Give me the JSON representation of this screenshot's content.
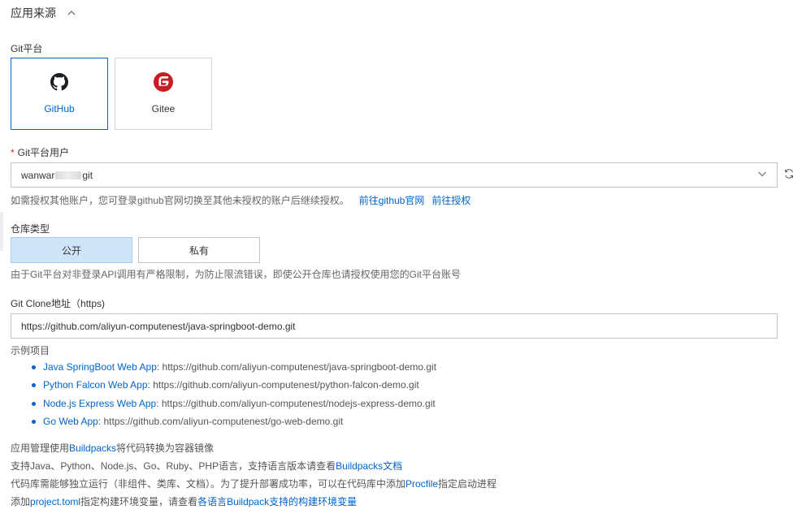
{
  "section": {
    "title": "应用来源"
  },
  "git_platform": {
    "label": "Git平台",
    "options": [
      {
        "name": "GitHub",
        "selected": true
      },
      {
        "name": "Gitee",
        "selected": false
      }
    ]
  },
  "git_user": {
    "required_mark": "*",
    "label": "Git平台用户",
    "value_prefix": "wanwar",
    "value_suffix": "git",
    "help_text": "如需授权其他账户，您可登录github官网切换至其他未授权的账户后继续授权。",
    "link_github": "前往github官网",
    "link_auth": "前往授权"
  },
  "repo_type": {
    "label": "仓库类型",
    "options": [
      {
        "label": "公开",
        "selected": true
      },
      {
        "label": "私有",
        "selected": false
      }
    ],
    "help_text": "由于Git平台对非登录API调用有严格限制，为防止限流错误，即使公开仓库也请授权使用您的Git平台账号"
  },
  "clone_url": {
    "label": "Git Clone地址（https)",
    "value": "https://github.com/aliyun-computenest/java-springboot-demo.git"
  },
  "examples": {
    "label": "示例项目",
    "items": [
      {
        "name": "Java SpringBoot Web App",
        "url": ": https://github.com/aliyun-computenest/java-springboot-demo.git"
      },
      {
        "name": "Python Falcon Web App",
        "url": ": https://github.com/aliyun-computenest/python-falcon-demo.git"
      },
      {
        "name": "Node.js Express Web App",
        "url": ": https://github.com/aliyun-computenest/nodejs-express-demo.git"
      },
      {
        "name": "Go Web App",
        "url": ": https://github.com/aliyun-computenest/go-web-demo.git"
      }
    ]
  },
  "notes": {
    "line1_a": "应用管理使用",
    "line1_link": "Buildpacks",
    "line1_b": "将代码转换为容器镜像",
    "line2_a": "支持Java、Python、Node.js、Go、Ruby、PHP语言，支持语言版本请查看",
    "line2_link": "Buildpacks文档",
    "line3_a": "代码库需能够独立运行（非组件、类库、文档）。为了提升部署成功率，可以在代码库中添加",
    "line3_link": "Procfile",
    "line3_b": "指定启动进程",
    "line4_a": "添加",
    "line4_link": "project.toml",
    "line4_b": "指定构建环境变量，请查看",
    "line4_link2": "各语言Buildpack支持的构建环境变量"
  },
  "colors": {
    "accent": "#0064c8",
    "selected_bg": "#cfe4f8",
    "required": "#d93026",
    "gitee_red": "#c71d23"
  },
  "icons": [
    "chevron-up-icon",
    "github-icon",
    "gitee-icon",
    "chevron-down-icon",
    "refresh-icon"
  ]
}
